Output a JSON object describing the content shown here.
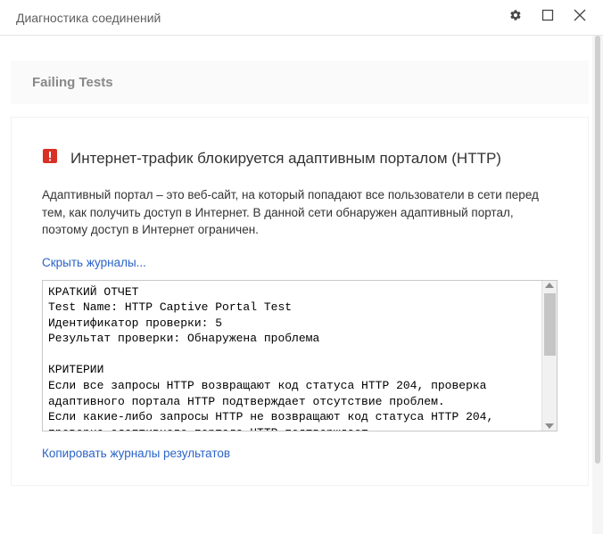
{
  "titlebar": {
    "title": "Диагностика соединений"
  },
  "section": {
    "header": "Failing Tests"
  },
  "card": {
    "title": "Интернет-трафик блокируется адаптивным порталом (HTTP)",
    "description": "Адаптивный портал – это веб-сайт, на который попадают все пользователи в сети перед тем, как получить доступ в Интернет. В данной сети обнаружен адаптивный портал, поэтому доступ в Интернет ограничен.",
    "hide_logs_link": "Скрыть журналы...",
    "log_text": "КРАТКИЙ ОТЧЕТ\nTest Name: HTTP Captive Portal Test\nИдентификатор проверки: 5\nРезультат проверки: Обнаружена проблема\n\nКРИТЕРИИ\nЕсли все запросы HTTP возвращают код статуса HTTP 204, проверка адаптивного портала HTTP подтверждает отсутствие проблем.\nЕсли какие-либо запросы HTTP не возвращают код статуса HTTP 204, проверка адаптивного портала HTTP подтверждает",
    "copy_logs_link": "Копировать журналы результатов"
  }
}
